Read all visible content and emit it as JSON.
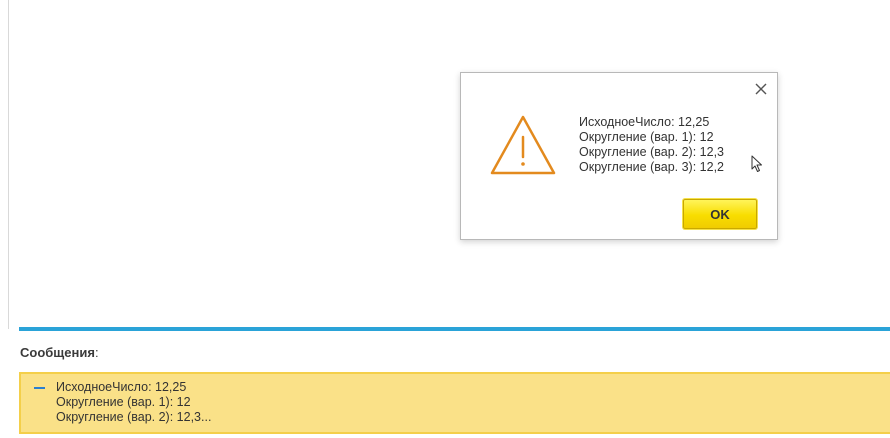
{
  "dialog": {
    "icon": "warning-triangle-icon",
    "lines": [
      "ИсходноеЧисло: 12,25",
      "Округление (вар. 1): 12",
      "Округление (вар. 2): 12,3",
      "Округление (вар. 3): 12,2"
    ],
    "ok_label": "OK"
  },
  "messages": {
    "label": "Сообщения",
    "label_suffix": ":",
    "lines": [
      "ИсходноеЧисло: 12,25",
      "Округление (вар. 1): 12",
      "Округление (вар. 2): 12,3..."
    ]
  },
  "colors": {
    "accent_bar": "#2aa3d8",
    "warning_icon": "#e38a1e",
    "ok_button": "#f8dd00",
    "messages_background": "#fae188"
  }
}
